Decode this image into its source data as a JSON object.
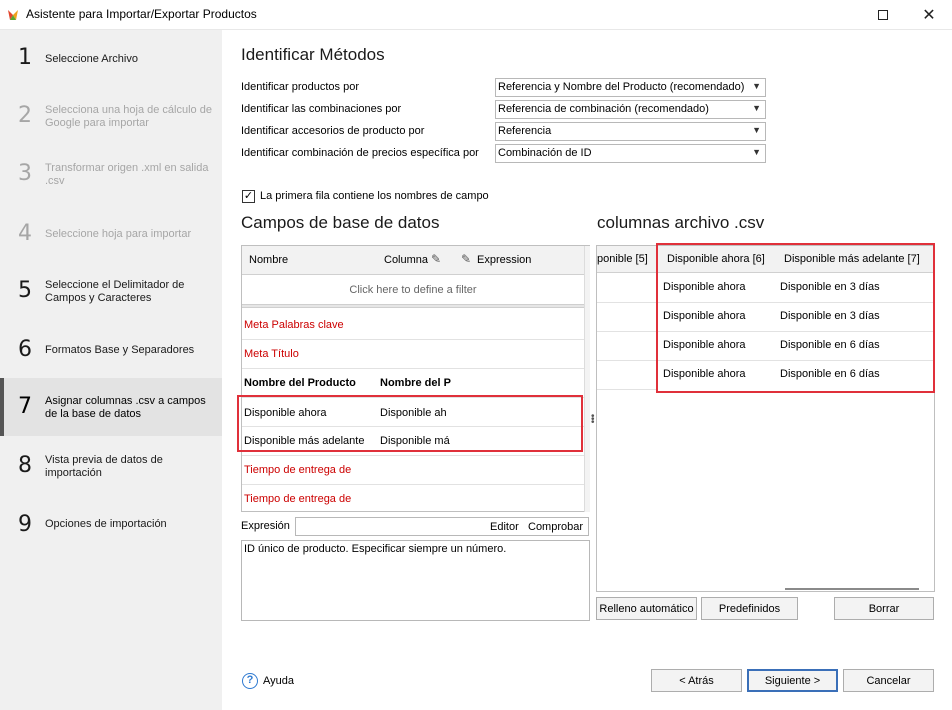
{
  "window": {
    "title": "Asistente para Importar/Exportar Productos",
    "maximize_icon": "maximize-icon",
    "close_icon": "close-icon"
  },
  "sidebar": {
    "steps": [
      {
        "num": "1",
        "label": "Seleccione Archivo",
        "state": "done"
      },
      {
        "num": "2",
        "label": "Selecciona una hoja de cálculo de Google para importar",
        "state": "disabled"
      },
      {
        "num": "3",
        "label": "Transformar origen .xml en salida .csv",
        "state": "disabled"
      },
      {
        "num": "4",
        "label": "Seleccione hoja para importar",
        "state": "disabled"
      },
      {
        "num": "5",
        "label": "Seleccione el Delimitador de Campos y Caracteres",
        "state": "done"
      },
      {
        "num": "6",
        "label": "Formatos Base y Separadores",
        "state": "done"
      },
      {
        "num": "7",
        "label": "Asignar columnas .csv a campos de la base de datos",
        "state": "active"
      },
      {
        "num": "8",
        "label": "Vista previa de datos de importación",
        "state": "done"
      },
      {
        "num": "9",
        "label": "Opciones de importación",
        "state": "done"
      }
    ]
  },
  "identify": {
    "title": "Identificar Métodos",
    "rows": [
      {
        "label": "Identificar productos por",
        "value": "Referencia y Nombre del Producto (recomendado)"
      },
      {
        "label": "Identificar las combinaciones por",
        "value": "Referencia de combinación (recomendado)"
      },
      {
        "label": "Identificar accesorios de producto por",
        "value": "Referencia"
      },
      {
        "label": "Identificar combinación de precios específica por",
        "value": "Combinación de ID"
      }
    ],
    "first_row_checkbox": "La primera fila contiene los nombres de campo",
    "first_row_checked": "✓"
  },
  "db_fields": {
    "title": "Campos de base de datos",
    "col_name": "Nombre",
    "col_column": "Columna",
    "col_expression": "Expression",
    "filter_text": "Click here to define a filter",
    "rows": [
      {
        "name": "Meta Palabras clave",
        "column": "",
        "style": "red"
      },
      {
        "name": "Meta Título",
        "column": "",
        "style": "red"
      },
      {
        "name": "Nombre del Producto",
        "column": "Nombre del P",
        "style": "bold"
      },
      {
        "name": "Disponible ahora",
        "column": "Disponible ah",
        "style": "normal"
      },
      {
        "name": "Disponible más adelante",
        "column": "Disponible má",
        "style": "normal"
      },
      {
        "name": "Tiempo de entrega de",
        "column": "",
        "style": "red"
      },
      {
        "name": "Tiempo de entrega de",
        "column": "",
        "style": "red"
      }
    ],
    "expression_label": "Expresión",
    "editor_btn": "Editor",
    "check_btn": "Comprobar",
    "description": "ID único de producto. Especificar siempre un número."
  },
  "csv": {
    "title": "columnas archivo .csv",
    "headers": [
      "ponible [5]",
      "Disponible ahora [6]",
      "Disponible más adelante [7]"
    ],
    "rows": [
      [
        "",
        "Disponible ahora",
        "Disponible en 3 días"
      ],
      [
        "",
        "Disponible ahora",
        "Disponible en 3 días"
      ],
      [
        "",
        "Disponible ahora",
        "Disponible en 6 días"
      ],
      [
        "",
        "Disponible ahora",
        "Disponible  en 6 días"
      ]
    ],
    "autofill_btn": "Relleno automático",
    "defaults_btn": "Predefinidos",
    "clear_btn": "Borrar"
  },
  "footer": {
    "help": "Ayuda",
    "back": "< Atrás",
    "next": "Siguiente >",
    "cancel": "Cancelar"
  },
  "colors": {
    "highlight": "#e0303a",
    "sidebar_bg": "#f0f0f0",
    "red_field": "#cc0000"
  }
}
